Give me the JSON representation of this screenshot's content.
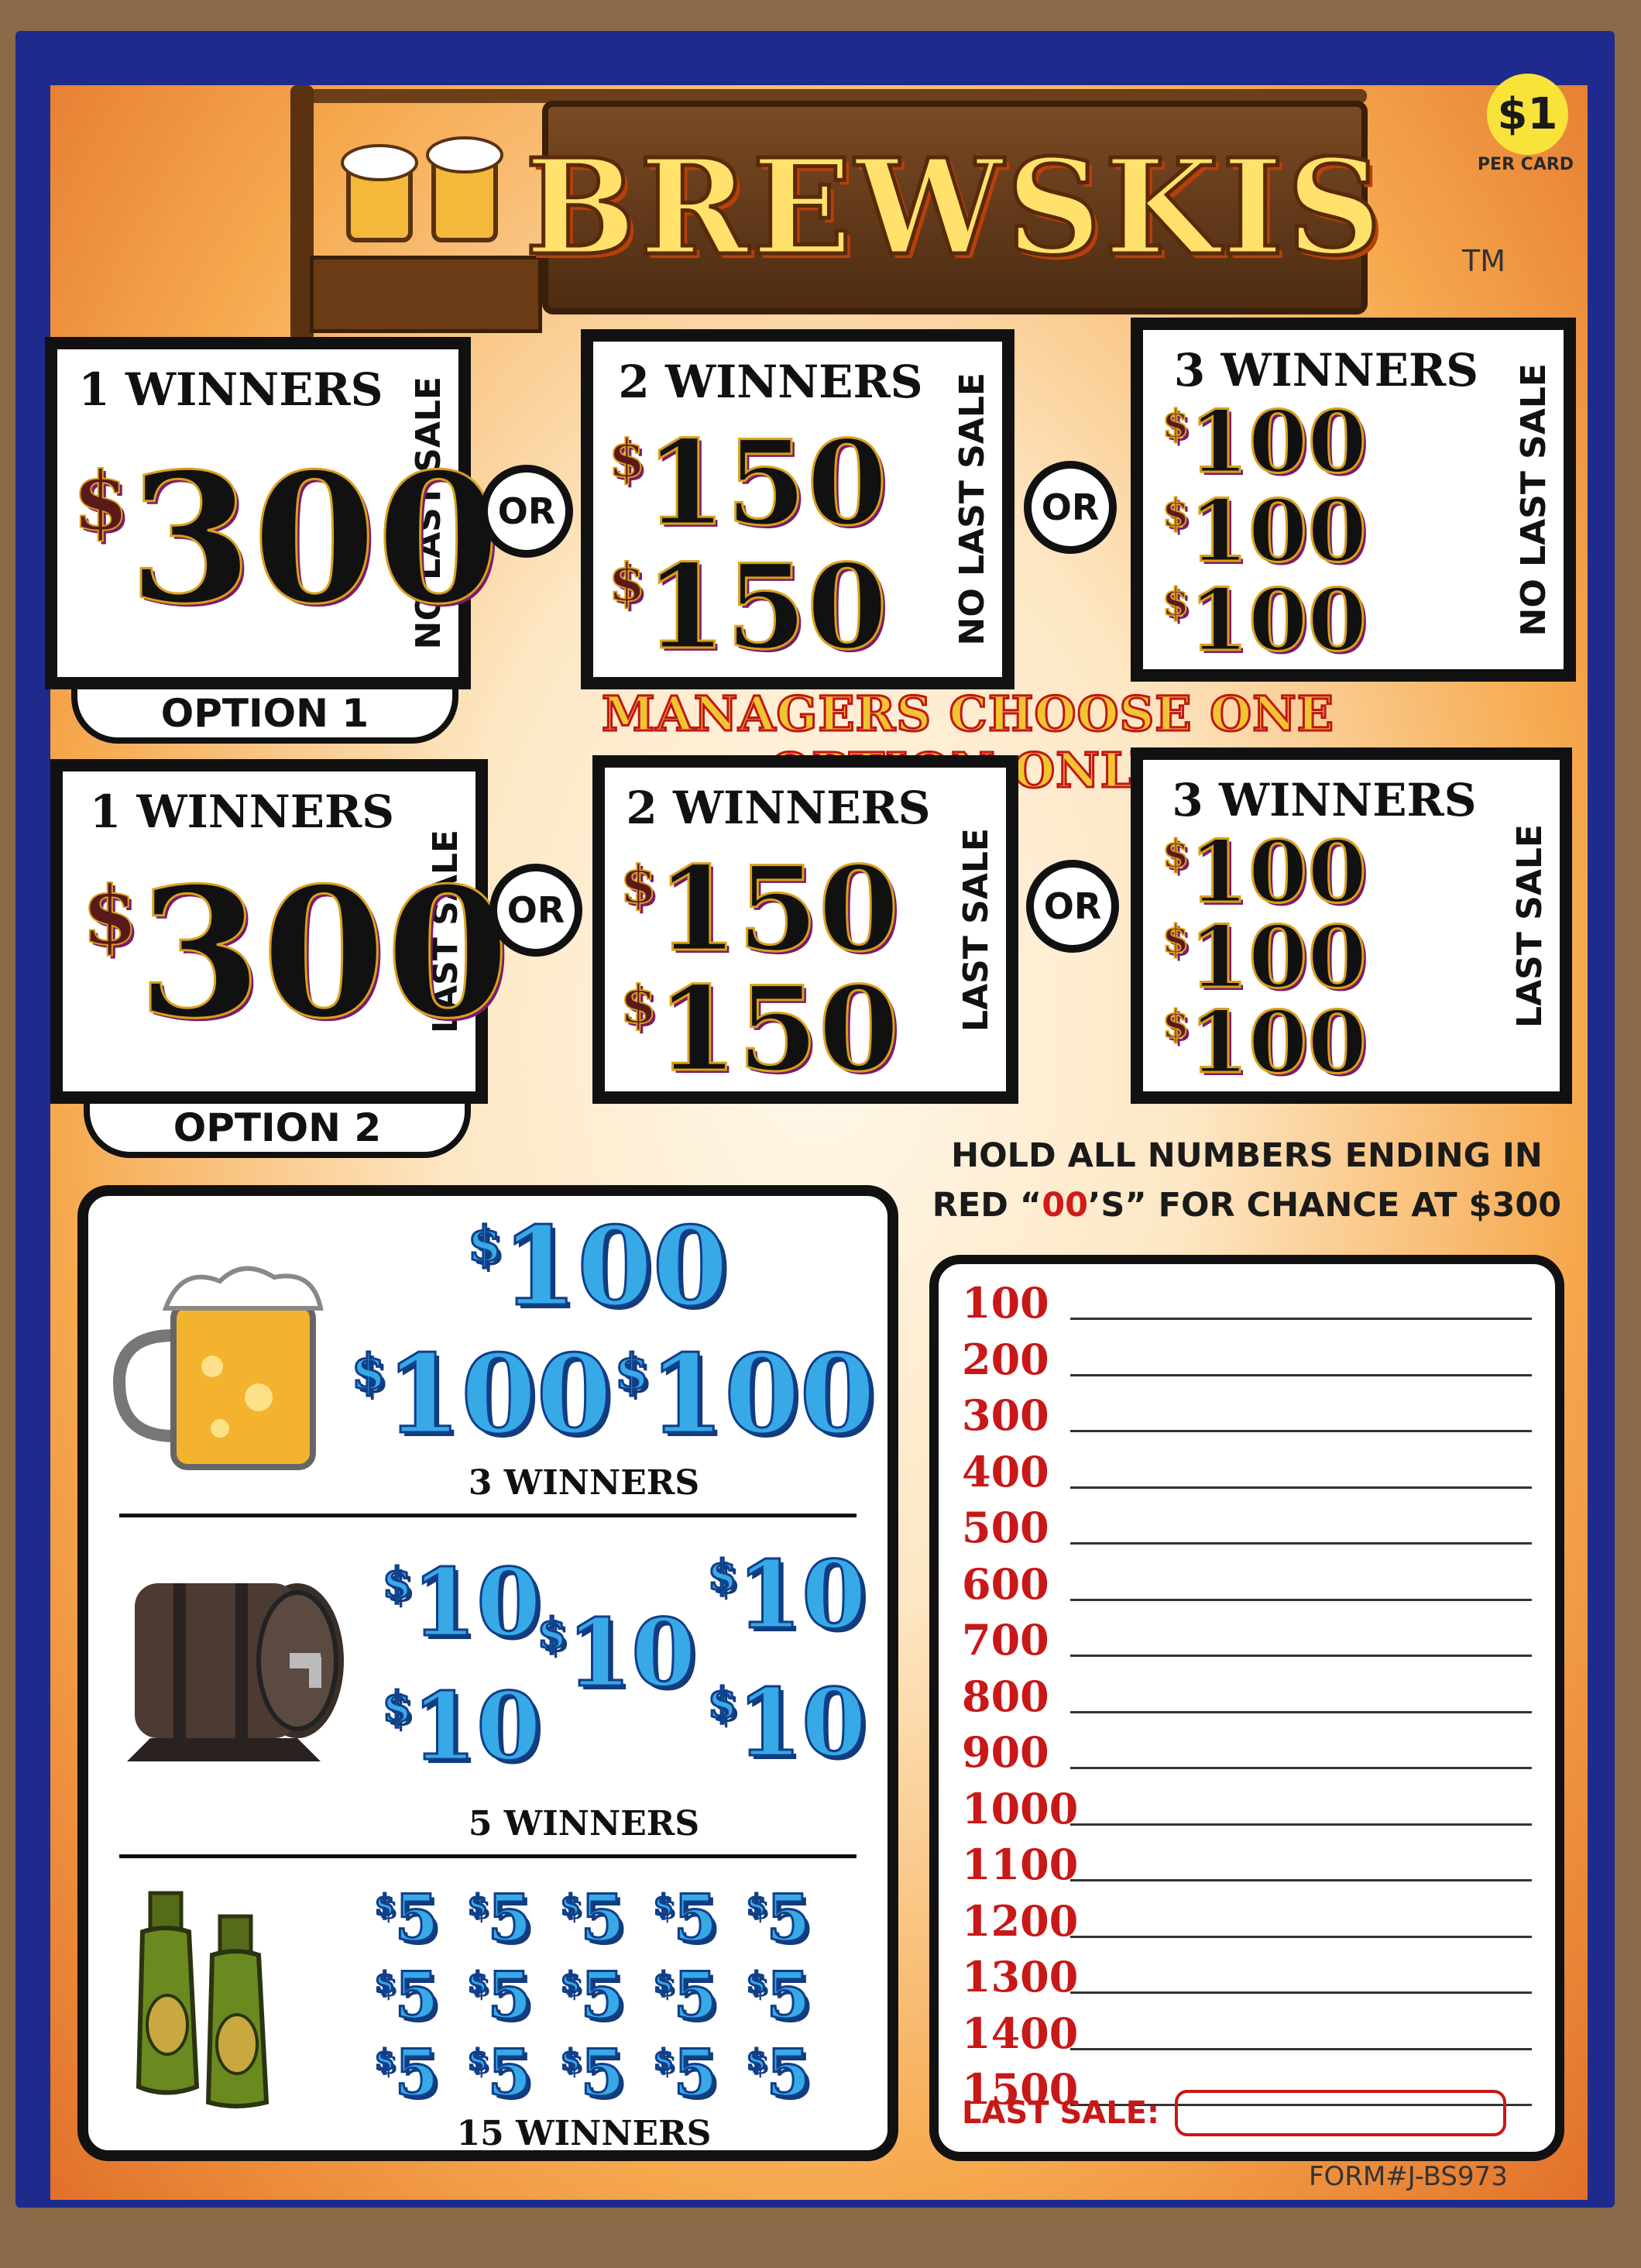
{
  "header": {
    "title": "BREWSKIS",
    "price": "$1",
    "price_sub": "PER CARD",
    "trademark": "TM"
  },
  "option1": {
    "label": "OPTION 1",
    "boxes": [
      {
        "head": "1 WINNERS",
        "side": "NO LAST SALE",
        "amounts": [
          "300"
        ]
      },
      {
        "head": "2 WINNERS",
        "side": "NO LAST SALE",
        "amounts": [
          "150",
          "150"
        ]
      },
      {
        "head": "3 WINNERS",
        "side": "NO LAST SALE",
        "amounts": [
          "100",
          "100",
          "100"
        ]
      }
    ]
  },
  "option2": {
    "label": "OPTION 2",
    "boxes": [
      {
        "head": "1 WINNERS",
        "side": "LAST SALE",
        "amounts": [
          "300"
        ]
      },
      {
        "head": "2 WINNERS",
        "side": "LAST SALE",
        "amounts": [
          "150",
          "150"
        ]
      },
      {
        "head": "3 WINNERS",
        "side": "LAST SALE",
        "amounts": [
          "100",
          "100",
          "100"
        ]
      }
    ]
  },
  "or_label": "OR",
  "dollar": "$",
  "managers_note": "MANAGERS CHOOSE ONE OPTION ONLY",
  "hold_note": {
    "line1": "HOLD ALL NUMBERS ENDING IN",
    "line2_pre": "RED “",
    "line2_red": "00",
    "line2_post": "’S” FOR CHANCE AT $300"
  },
  "prizes": {
    "beer": {
      "amounts": [
        "100",
        "100",
        "100"
      ],
      "winners": "3 WINNERS"
    },
    "keg": {
      "amounts": [
        "10",
        "10",
        "10",
        "10",
        "10"
      ],
      "winners": "5 WINNERS"
    },
    "bottles": {
      "amounts": [
        "5",
        "5",
        "5",
        "5",
        "5",
        "5",
        "5",
        "5",
        "5",
        "5",
        "5",
        "5",
        "5",
        "5",
        "5"
      ],
      "winners": "15 WINNERS"
    }
  },
  "number_list": [
    "100",
    "200",
    "300",
    "400",
    "500",
    "600",
    "700",
    "800",
    "900",
    "1000",
    "1100",
    "1200",
    "1300",
    "1400",
    "1500"
  ],
  "last_sale_label": "LAST SALE:",
  "form_number": "FORM#J-BS973",
  "colors": {
    "frame": "#1e2b8c",
    "accent_red": "#c81818",
    "prize_blue": "#37a9e6",
    "badge_yellow": "#f7e33a"
  }
}
